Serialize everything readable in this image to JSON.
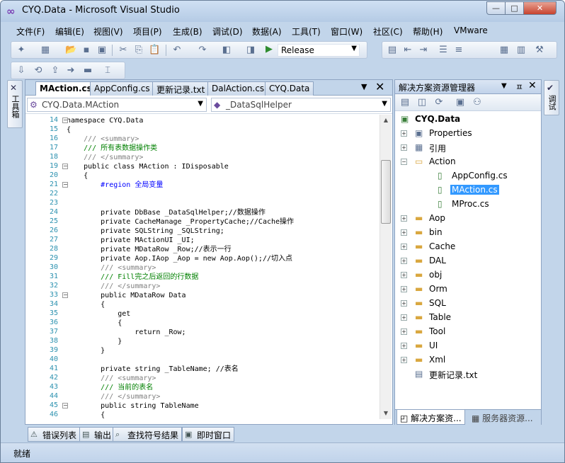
{
  "window": {
    "title": "CYQ.Data - Microsoft Visual Studio",
    "minimize": "—",
    "maximize": "□",
    "close": "✕"
  },
  "menu": [
    "文件(F)",
    "编辑(E)",
    "视图(V)",
    "项目(P)",
    "生成(B)",
    "调试(D)",
    "数据(A)",
    "工具(T)",
    "窗口(W)",
    "社区(C)",
    "帮助(H)",
    "VMware"
  ],
  "toolbar": {
    "configuration": "Release"
  },
  "toolbox": {
    "label": "工具箱"
  },
  "debug_panel": {
    "label": "调试"
  },
  "editor": {
    "tabs": [
      "MAction.cs",
      "AppConfig.cs",
      "更新记录.txt",
      "DalAction.cs",
      "CYQ.Data"
    ],
    "active_tab": "MAction.cs",
    "type_combo": "CYQ.Data.MAction",
    "member_combo": "_DataSqlHelper",
    "lines": [
      {
        "n": "14",
        "t": "namespace CYQ.Data"
      },
      {
        "n": "15",
        "t": "{"
      },
      {
        "n": "16",
        "t": "    /// <summary>"
      },
      {
        "n": "17",
        "t": "    /// 所有表数据操作类"
      },
      {
        "n": "18",
        "t": "    /// </summary>"
      },
      {
        "n": "19",
        "t": "    public class MAction : IDisposable"
      },
      {
        "n": "20",
        "t": "    {"
      },
      {
        "n": "21",
        "t": "        #region 全局变量"
      },
      {
        "n": "22",
        "t": ""
      },
      {
        "n": "23",
        "t": ""
      },
      {
        "n": "24",
        "t": "        private DbBase _DataSqlHelper;//数据操作"
      },
      {
        "n": "25",
        "t": "        private CacheManage _PropertyCache;//Cache操作"
      },
      {
        "n": "26",
        "t": "        private SQLString _SQLString;"
      },
      {
        "n": "27",
        "t": "        private MActionUI _UI;"
      },
      {
        "n": "28",
        "t": "        private MDataRow _Row;//表示一行"
      },
      {
        "n": "29",
        "t": "        private Aop.IAop _Aop = new Aop.Aop();//切入点"
      },
      {
        "n": "30",
        "t": "        /// <summary>"
      },
      {
        "n": "31",
        "t": "        /// Fill完之后返回的行数据"
      },
      {
        "n": "32",
        "t": "        /// </summary>"
      },
      {
        "n": "33",
        "t": "        public MDataRow Data"
      },
      {
        "n": "34",
        "t": "        {"
      },
      {
        "n": "35",
        "t": "            get"
      },
      {
        "n": "36",
        "t": "            {"
      },
      {
        "n": "37",
        "t": "                return _Row;"
      },
      {
        "n": "38",
        "t": "            }"
      },
      {
        "n": "39",
        "t": "        }"
      },
      {
        "n": "40",
        "t": ""
      },
      {
        "n": "41",
        "t": "        private string _TableName; //表名"
      },
      {
        "n": "42",
        "t": "        /// <summary>"
      },
      {
        "n": "43",
        "t": "        /// 当前的表名"
      },
      {
        "n": "44",
        "t": "        /// </summary>"
      },
      {
        "n": "45",
        "t": "        public string TableName"
      },
      {
        "n": "46",
        "t": "        {"
      }
    ]
  },
  "solution_explorer": {
    "title": "解决方案资源管理器",
    "pin": "ㅍ",
    "close": "✕",
    "project": "CYQ.Data",
    "items": [
      {
        "label": "Properties",
        "icon": "properties-icon",
        "level": 1,
        "expander": "+"
      },
      {
        "label": "引用",
        "icon": "references-icon",
        "level": 1,
        "expander": "+"
      },
      {
        "label": "Action",
        "icon": "folder-open-icon",
        "level": 1,
        "expander": "−"
      },
      {
        "label": "AppConfig.cs",
        "icon": "cs-file-icon",
        "level": 2,
        "expander": ""
      },
      {
        "label": "MAction.cs",
        "icon": "cs-file-icon",
        "level": 2,
        "expander": "",
        "selected": true
      },
      {
        "label": "MProc.cs",
        "icon": "cs-file-icon",
        "level": 2,
        "expander": ""
      },
      {
        "label": "Aop",
        "icon": "folder-icon",
        "level": 1,
        "expander": "+"
      },
      {
        "label": "bin",
        "icon": "folder-icon",
        "level": 1,
        "expander": "+"
      },
      {
        "label": "Cache",
        "icon": "folder-icon",
        "level": 1,
        "expander": "+"
      },
      {
        "label": "DAL",
        "icon": "folder-icon",
        "level": 1,
        "expander": "+"
      },
      {
        "label": "obj",
        "icon": "folder-icon",
        "level": 1,
        "expander": "+"
      },
      {
        "label": "Orm",
        "icon": "folder-icon",
        "level": 1,
        "expander": "+"
      },
      {
        "label": "SQL",
        "icon": "folder-icon",
        "level": 1,
        "expander": "+"
      },
      {
        "label": "Table",
        "icon": "folder-icon",
        "level": 1,
        "expander": "+"
      },
      {
        "label": "Tool",
        "icon": "folder-icon",
        "level": 1,
        "expander": "+"
      },
      {
        "label": "UI",
        "icon": "folder-icon",
        "level": 1,
        "expander": "+"
      },
      {
        "label": "Xml",
        "icon": "folder-icon",
        "level": 1,
        "expander": "+"
      },
      {
        "label": "更新记录.txt",
        "icon": "text-file-icon",
        "level": 1,
        "expander": ""
      }
    ],
    "bottom_tabs": [
      "解决方案资...",
      "服务器资源..."
    ]
  },
  "tool_tabs": [
    "错误列表",
    "输出",
    "查找符号结果",
    "即时窗口"
  ],
  "status": {
    "text": "就绪"
  }
}
